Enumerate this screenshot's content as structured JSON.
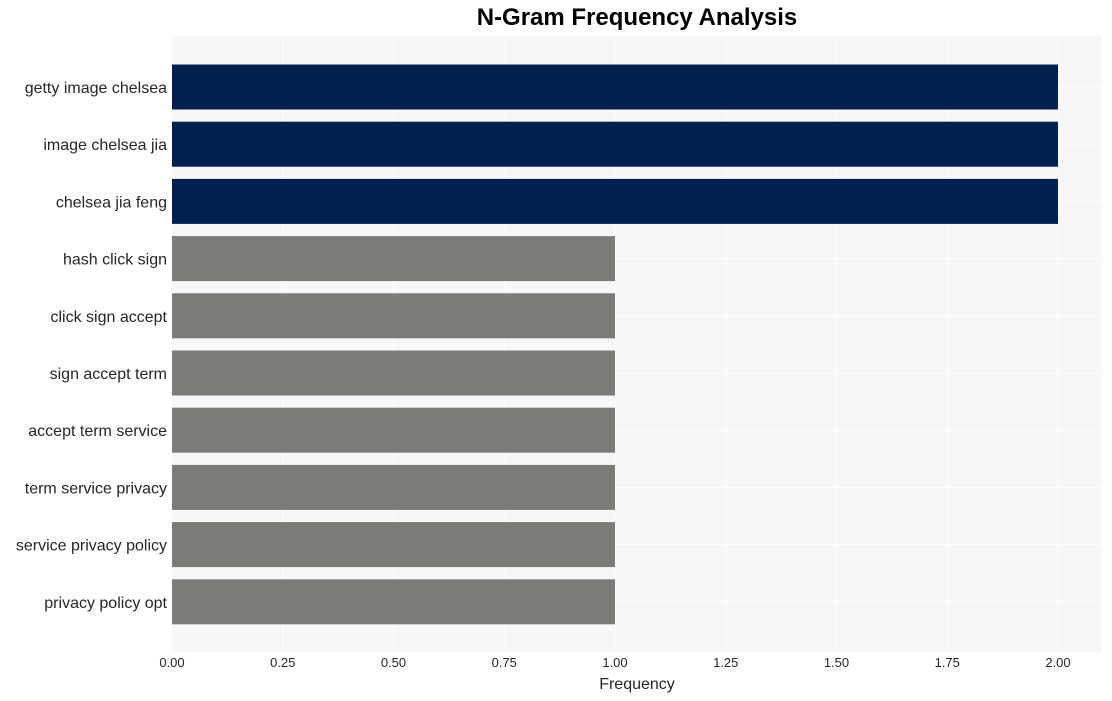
{
  "chart_data": {
    "type": "bar",
    "orientation": "horizontal",
    "title": "N-Gram Frequency Analysis",
    "xlabel": "Frequency",
    "ylabel": "",
    "categories": [
      "getty image chelsea",
      "image chelsea jia",
      "chelsea jia feng",
      "hash click sign",
      "click sign accept",
      "sign accept term",
      "accept term service",
      "term service privacy",
      "service privacy policy",
      "privacy policy opt"
    ],
    "values": [
      2,
      2,
      2,
      1,
      1,
      1,
      1,
      1,
      1,
      1
    ],
    "xlim": [
      0,
      2.1
    ],
    "xticks": [
      "0.00",
      "0.25",
      "0.50",
      "0.75",
      "1.00",
      "1.25",
      "1.50",
      "1.75",
      "2.00"
    ],
    "xtick_values": [
      0,
      0.25,
      0.5,
      0.75,
      1.0,
      1.25,
      1.5,
      1.75,
      2.0
    ],
    "grid": true,
    "colors": {
      "highlight": "#00214d",
      "normal": "#7c7b78",
      "plot_background": "#f7f7f7",
      "grid": "#ffffff"
    }
  }
}
